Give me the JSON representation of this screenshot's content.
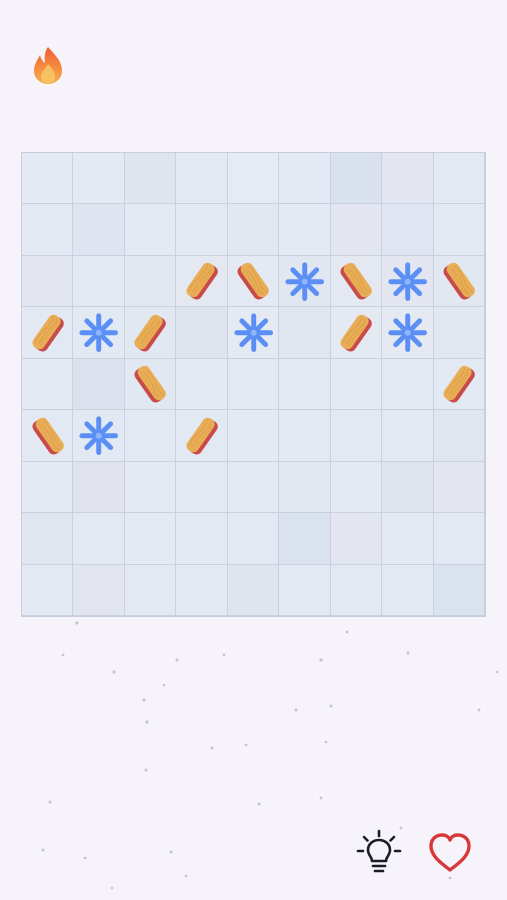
{
  "header": {
    "streak_icon": "flame-icon"
  },
  "board": {
    "rows": 9,
    "cols": 9,
    "cell_colors": [
      [
        "#e4eaf3",
        "#e3eaf2",
        "#e0e4ef",
        "#e3e8f2",
        "#e5ebf4",
        "#e3eaf3",
        "#d9e1ee",
        "#e3e5f0",
        "#e2e9f3"
      ],
      [
        "#e3e9f2",
        "#dee5f0",
        "#e4e9f2",
        "#e3e9f2",
        "#e2e8f2",
        "#e3eaf3",
        "#e3e6f0",
        "#dfe6f1",
        "#e3e9f3"
      ],
      [
        "#e2e5ef",
        "#e3e9f2",
        "#e1e8f2",
        "#e3e8f1",
        "#e4eaf3",
        "#e1e7f1",
        "#e3e8f1",
        "#e3e6f0",
        "#e1e8f2"
      ],
      [
        "#e3e9f3",
        "#e3e9f2",
        "#e2e8f2",
        "#dfe3ee",
        "#e4e9f2",
        "#dfe6f0",
        "#e4e9f2",
        "#e4e9f2",
        "#e2e8f2"
      ],
      [
        "#e3e9f2",
        "#dbe2ed",
        "#e2e8f2",
        "#e4e9f3",
        "#e3e9f2",
        "#e3e9f2",
        "#e4eaf3",
        "#e3e9f2",
        "#e3e9f2"
      ],
      [
        "#e3e9f2",
        "#e3e9f2",
        "#e3e9f2",
        "#e3e9f2",
        "#e4eaf3",
        "#e3e9f2",
        "#e3e9f2",
        "#e3e9f2",
        "#dfe6f0"
      ],
      [
        "#e4eaf3",
        "#e0e3ee",
        "#e4eaf3",
        "#e3e9f2",
        "#e3e9f2",
        "#e2e8f2",
        "#e4eaf3",
        "#e0e4ef",
        "#e3e5f0"
      ],
      [
        "#dfe6f0",
        "#e3e9f2",
        "#e4eaf3",
        "#e3e9f2",
        "#e3e9f2",
        "#dae2ee",
        "#e3e6f0",
        "#e3e9f2",
        "#e3e9f2"
      ],
      [
        "#e3e9f2",
        "#e2e5ef",
        "#e3e9f2",
        "#e3e9f2",
        "#e0e4ef",
        "#e3e9f2",
        "#e3e9f2",
        "#e3e9f2",
        "#dae2ee"
      ]
    ],
    "pieces": [
      {
        "type": "plank",
        "direction": "up-right",
        "row": 2,
        "col": 3
      },
      {
        "type": "plank",
        "direction": "down-right",
        "row": 2,
        "col": 4
      },
      {
        "type": "plank",
        "direction": "down-right",
        "row": 2,
        "col": 6
      },
      {
        "type": "plank",
        "direction": "down-right",
        "row": 2,
        "col": 8
      },
      {
        "type": "plank",
        "direction": "up-right",
        "row": 3,
        "col": 0
      },
      {
        "type": "plank",
        "direction": "up-right",
        "row": 3,
        "col": 2
      },
      {
        "type": "plank",
        "direction": "up-right",
        "row": 3,
        "col": 6
      },
      {
        "type": "plank",
        "direction": "down-right",
        "row": 4,
        "col": 2
      },
      {
        "type": "plank",
        "direction": "up-right",
        "row": 4,
        "col": 8
      },
      {
        "type": "plank",
        "direction": "down-right",
        "row": 5,
        "col": 0
      },
      {
        "type": "plank",
        "direction": "up-right",
        "row": 5,
        "col": 3
      },
      {
        "type": "snowflake",
        "row": 2,
        "col": 5
      },
      {
        "type": "snowflake",
        "row": 2,
        "col": 7
      },
      {
        "type": "snowflake",
        "row": 3,
        "col": 1
      },
      {
        "type": "snowflake",
        "row": 3,
        "col": 4
      },
      {
        "type": "snowflake",
        "row": 3,
        "col": 7
      },
      {
        "type": "snowflake",
        "row": 5,
        "col": 1
      }
    ]
  },
  "controls": {
    "hint_icon": "lightbulb-icon",
    "lives_icon": "heart-icon"
  },
  "colors": {
    "background": "#f6f4fa",
    "plank_top": "#e8ad55",
    "plank_side": "#c94a4a",
    "snowflake": "#5b8ff5",
    "heart": "#d8383a",
    "flame_outer": "#f16a33",
    "flame_inner": "#f9bd58"
  }
}
